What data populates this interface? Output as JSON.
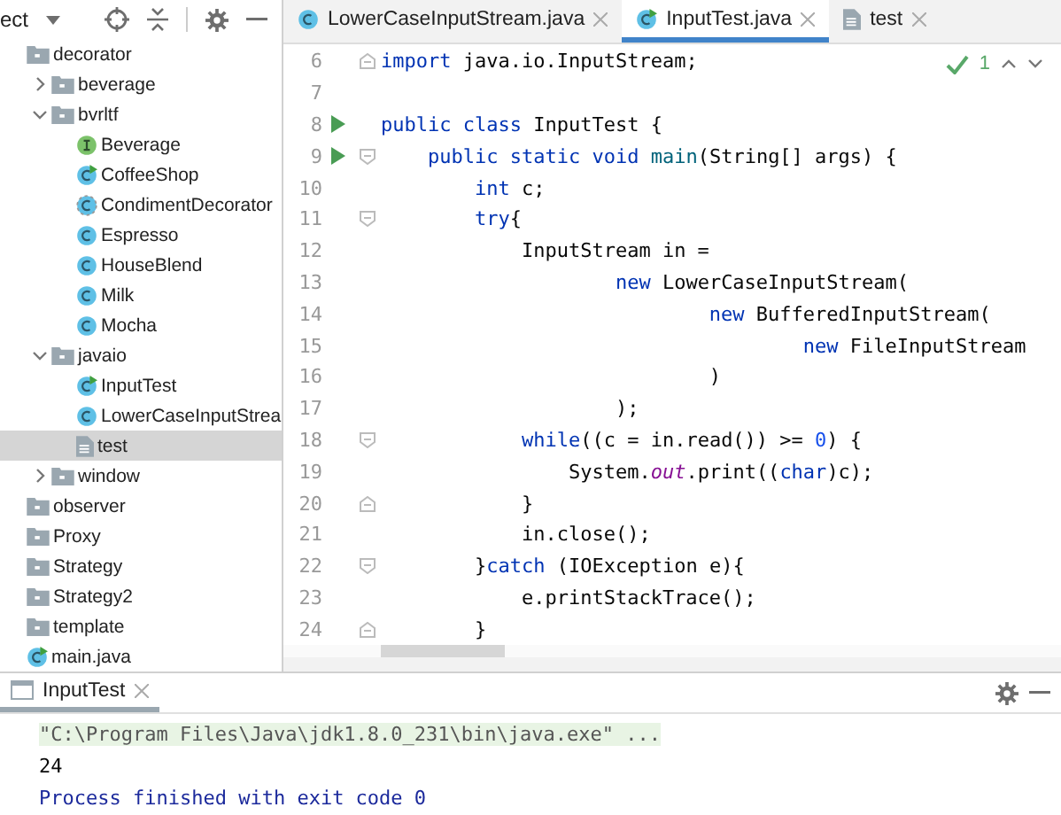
{
  "project_panel": {
    "title": "ect",
    "tree": [
      {
        "label": "decorator",
        "kind": "folder",
        "selected": false,
        "children": [
          {
            "label": "beverage",
            "kind": "folder",
            "expanded": false,
            "selected": false
          },
          {
            "label": "bvrltf",
            "kind": "folder",
            "expanded": true,
            "selected": false,
            "children": [
              {
                "label": "Beverage",
                "kind": "interface",
                "selected": false
              },
              {
                "label": "CoffeeShop",
                "kind": "runnable",
                "selected": false
              },
              {
                "label": "CondimentDecorator",
                "kind": "abstract",
                "selected": false
              },
              {
                "label": "Espresso",
                "kind": "class",
                "selected": false
              },
              {
                "label": "HouseBlend",
                "kind": "class",
                "selected": false
              },
              {
                "label": "Milk",
                "kind": "class",
                "selected": false
              },
              {
                "label": "Mocha",
                "kind": "class",
                "selected": false
              }
            ]
          },
          {
            "label": "javaio",
            "kind": "folder",
            "expanded": true,
            "selected": false,
            "children": [
              {
                "label": "InputTest",
                "kind": "runnable",
                "selected": false
              },
              {
                "label": "LowerCaseInputStrea",
                "kind": "class",
                "selected": false
              },
              {
                "label": "test",
                "kind": "textfile",
                "selected": true
              }
            ]
          },
          {
            "label": "window",
            "kind": "folder",
            "expanded": false,
            "selected": false
          }
        ]
      },
      {
        "label": "observer",
        "kind": "folder",
        "selected": false
      },
      {
        "label": "Proxy",
        "kind": "folder",
        "selected": false
      },
      {
        "label": "Strategy",
        "kind": "folder",
        "selected": false
      },
      {
        "label": "Strategy2",
        "kind": "folder",
        "selected": false
      },
      {
        "label": "template",
        "kind": "folder",
        "selected": false
      },
      {
        "label": "main.java",
        "kind": "runnable",
        "selected": false
      }
    ]
  },
  "editor": {
    "tabs": [
      {
        "label": "LowerCaseInputStream.java",
        "kind": "class",
        "selected": false
      },
      {
        "label": "InputTest.java",
        "kind": "runnable",
        "selected": true
      },
      {
        "label": "test",
        "kind": "textfile",
        "selected": false
      }
    ],
    "inspection_count": "1",
    "lines": [
      {
        "number": "6",
        "fold_end": true,
        "tokens": [
          {
            "text": "import",
            "kind": "keyword"
          },
          {
            "text": " java.io.InputStream;",
            "kind": "plain"
          }
        ]
      },
      {
        "number": "7"
      },
      {
        "number": "8",
        "run": true,
        "tokens": [
          {
            "text": "public class",
            "kind": "keyword"
          },
          {
            "text": " InputTest {",
            "kind": "plain"
          }
        ]
      },
      {
        "number": "9",
        "run": true,
        "fold_start": true,
        "tokens": [
          {
            "text": "    public static void ",
            "kind": "keyword"
          },
          {
            "text": "main",
            "kind": "method"
          },
          {
            "text": "(String[] args) {",
            "kind": "plain"
          }
        ]
      },
      {
        "number": "10",
        "tokens": [
          {
            "text": "        int",
            "kind": "keyword"
          },
          {
            "text": " c;",
            "kind": "plain"
          }
        ]
      },
      {
        "number": "11",
        "fold_start": true,
        "tokens": [
          {
            "text": "        try",
            "kind": "keyword"
          },
          {
            "text": "{",
            "kind": "plain"
          }
        ]
      },
      {
        "number": "12",
        "tokens": [
          {
            "text": "            InputStream in =",
            "kind": "plain"
          }
        ]
      },
      {
        "number": "13",
        "tokens": [
          {
            "text": "                    new",
            "kind": "keyword"
          },
          {
            "text": " LowerCaseInputStream(",
            "kind": "plain"
          }
        ]
      },
      {
        "number": "14",
        "tokens": [
          {
            "text": "                            new",
            "kind": "keyword"
          },
          {
            "text": " BufferedInputStream(",
            "kind": "plain"
          }
        ]
      },
      {
        "number": "15",
        "tokens": [
          {
            "text": "                                    new",
            "kind": "keyword"
          },
          {
            "text": " FileInputStream",
            "kind": "plain"
          }
        ]
      },
      {
        "number": "16",
        "tokens": [
          {
            "text": "                            )",
            "kind": "plain"
          }
        ]
      },
      {
        "number": "17",
        "tokens": [
          {
            "text": "                    );",
            "kind": "plain"
          }
        ]
      },
      {
        "number": "18",
        "fold_start": true,
        "tokens": [
          {
            "text": "            while",
            "kind": "keyword"
          },
          {
            "text": "((c = in.read()) >= ",
            "kind": "plain"
          },
          {
            "text": "0",
            "kind": "number"
          },
          {
            "text": ") {",
            "kind": "plain"
          }
        ]
      },
      {
        "number": "19",
        "tokens": [
          {
            "text": "                System.",
            "kind": "plain"
          },
          {
            "text": "out",
            "kind": "field"
          },
          {
            "text": ".print((",
            "kind": "plain"
          },
          {
            "text": "char",
            "kind": "keyword"
          },
          {
            "text": ")c);",
            "kind": "plain"
          }
        ]
      },
      {
        "number": "20",
        "fold_end": true,
        "tokens": [
          {
            "text": "            }",
            "kind": "plain"
          }
        ]
      },
      {
        "number": "21",
        "tokens": [
          {
            "text": "            in.close();",
            "kind": "plain"
          }
        ]
      },
      {
        "number": "22",
        "fold_start": true,
        "tokens": [
          {
            "text": "        }",
            "kind": "plain"
          },
          {
            "text": "catch",
            "kind": "keyword"
          },
          {
            "text": " (IOException e){",
            "kind": "plain"
          }
        ]
      },
      {
        "number": "23",
        "tokens": [
          {
            "text": "            e.printStackTrace();",
            "kind": "plain"
          }
        ]
      },
      {
        "number": "24",
        "fold_end": true,
        "tokens": [
          {
            "text": "        }",
            "kind": "plain"
          }
        ]
      }
    ]
  },
  "run_panel": {
    "tab": {
      "label": "InputTest",
      "selected": true
    },
    "output": [
      {
        "text": "\"C:\\Program Files\\Java\\jdk1.8.0_231\\bin\\java.exe\" ...",
        "kind": "command"
      },
      {
        "text": "24",
        "kind": "stdout"
      },
      {
        "text": "Process finished with exit code 0",
        "kind": "system"
      }
    ]
  }
}
